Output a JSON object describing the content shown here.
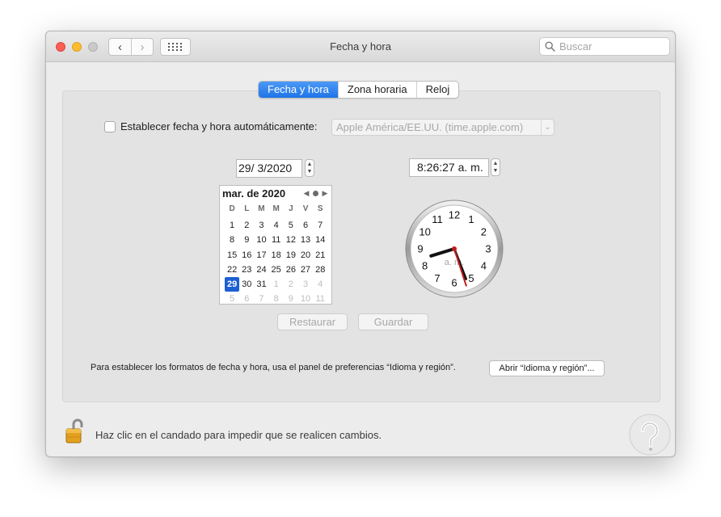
{
  "window": {
    "title": "Fecha y hora"
  },
  "search": {
    "placeholder": "Buscar"
  },
  "tabs": [
    {
      "label": "Fecha y hora",
      "active": true
    },
    {
      "label": "Zona horaria",
      "active": false
    },
    {
      "label": "Reloj",
      "active": false
    }
  ],
  "auto": {
    "label": "Establecer fecha y hora automáticamente:",
    "checked": false,
    "server": "Apple América/EE.UU. (time.apple.com)"
  },
  "date_field": "29/  3/2020",
  "time_field": "8:26:27 a. m.",
  "calendar": {
    "month_label": "mar. de 2020",
    "weekdays": [
      "D",
      "L",
      "M",
      "M",
      "J",
      "V",
      "S"
    ],
    "days": [
      "1",
      "2",
      "3",
      "4",
      "5",
      "6",
      "7",
      "8",
      "9",
      "10",
      "11",
      "12",
      "13",
      "14",
      "15",
      "16",
      "17",
      "18",
      "19",
      "20",
      "21",
      "22",
      "23",
      "24",
      "25",
      "26",
      "27",
      "28",
      "29",
      "30",
      "31",
      "1",
      "2",
      "3",
      "4",
      "5",
      "6",
      "7",
      "8",
      "9",
      "10",
      "11"
    ],
    "selected": "29"
  },
  "clock": {
    "numbers": [
      "12",
      "1",
      "2",
      "3",
      "4",
      "5",
      "6",
      "7",
      "8",
      "9",
      "10",
      "11"
    ],
    "ampm": "a. m.",
    "hour": 8,
    "minute": 26,
    "second": 27
  },
  "buttons": {
    "restore": "Restaurar",
    "save": "Guardar"
  },
  "format_note": "Para establecer los formatos de fecha y hora, usa el panel de preferencias “Idioma y región”.",
  "open_button": "Abrir “Idioma y región”...",
  "lock_note": "Haz clic en el candado para impedir que se realicen cambios.",
  "colors": {
    "accent": "#1f73e6",
    "selected_day": "#1c5fd1",
    "second_hand": "#c21b1b",
    "arrow": "#e8393a"
  },
  "icons": {
    "arrow": "red-arrow-icon",
    "lock": "padlock-icon",
    "logo": "question-mark-logo-icon"
  }
}
